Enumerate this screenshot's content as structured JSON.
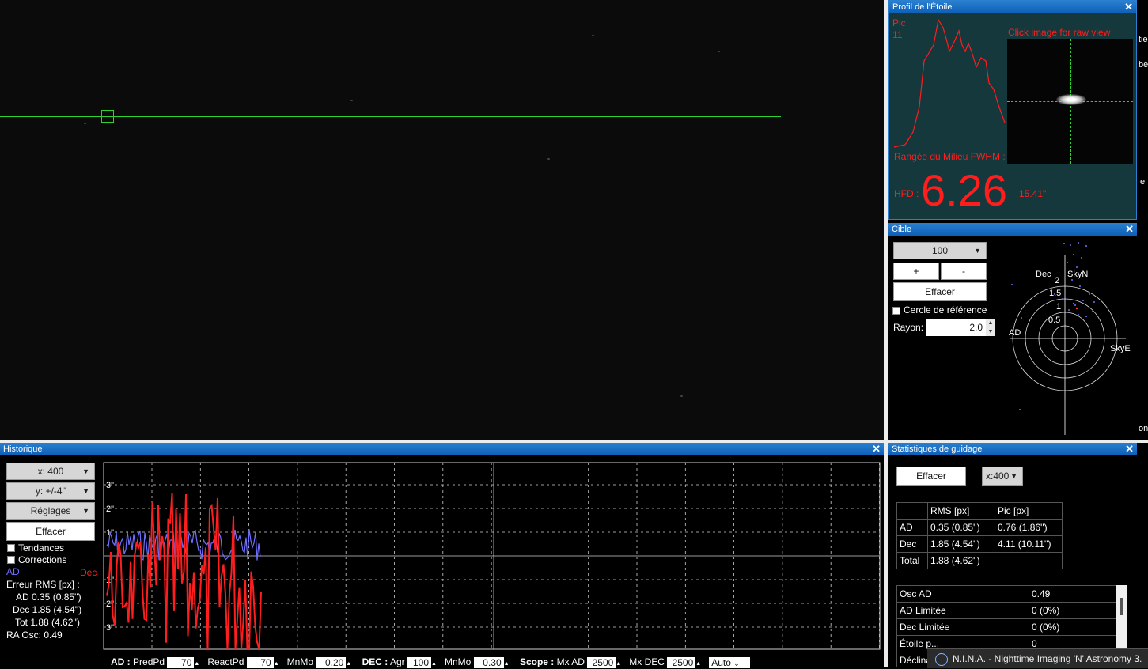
{
  "profile": {
    "title": "Profil de l'Étoile",
    "pic_label": "Pic",
    "pic_value": "11",
    "raw_hint": "Click image for raw view",
    "fwhm_label": "Rangée du Milieu FWHM :",
    "hfd_label": "HFD :",
    "hfd_value": "6.26",
    "hfd_arcsec": "15.41\""
  },
  "target": {
    "title": "Cible",
    "scale_value": "100",
    "plus": "+",
    "minus": "-",
    "clear": "Effacer",
    "ref_circle": "Cercle de référence",
    "radius_label": "Rayon:",
    "radius_value": "2.0",
    "labels": {
      "dec": "Dec",
      "skyn": "SkyN",
      "ad": "AD",
      "skye": "SkyE",
      "r2": "2",
      "r15": "1.5",
      "r1": "1",
      "r05": "0.5"
    }
  },
  "history": {
    "title": "Historique",
    "x_scale": "x: 400",
    "y_scale": "y: +/-4''",
    "settings": "Réglages",
    "clear": "Effacer",
    "trends": "Tendances",
    "corrections": "Corrections",
    "ad_legend": "AD",
    "dec_legend": "Dec",
    "rms_header": "Erreur RMS [px] :",
    "rms_ad": "AD  0.35 (0.85'')",
    "rms_dec": "Dec  1.85 (4.54'')",
    "rms_tot": "Tot  1.88 (4.62'')",
    "ra_osc": "RA Osc: 0.49",
    "y_ticks": [
      "3\"",
      "2\"",
      "1\"",
      "1\"",
      "2\"",
      "3\""
    ],
    "colors": {
      "ad": "#6f6fff",
      "dec": "#ff1e1e",
      "grid": "#cfcfcf"
    }
  },
  "stats": {
    "title": "Statistiques de guidage",
    "clear": "Effacer",
    "scale": "x:400",
    "headers": [
      "",
      "RMS [px]",
      "Pic [px]"
    ],
    "rows": [
      [
        "AD",
        "0.35 (0.85'')",
        "0.76 (1.86'')"
      ],
      [
        "Dec",
        "1.85 (4.54'')",
        "4.11 (10.11'')"
      ],
      [
        "Total",
        "1.88 (4.62'')",
        ""
      ]
    ],
    "rows2": [
      [
        "Osc AD",
        "0.49"
      ],
      [
        "AD Limitée",
        "0 (0%)"
      ],
      [
        "Dec Limitée",
        "0 (0%)"
      ],
      [
        "Étoile p...",
        "0"
      ],
      [
        "Déclina...",
        ""
      ]
    ]
  },
  "bottom_bar": {
    "ad_label": "AD :",
    "predpd_label": "PredPd",
    "predpd_value": "70",
    "reactpd_label": "ReactPd",
    "reactpd_value": "70",
    "mnmo_label": "MnMo",
    "mnmo_value": "0.20",
    "dec_label": "DEC :",
    "agr_label": "Agr",
    "agr_value": "100",
    "mnmo2_label": "MnMo",
    "mnmo2_value": "0.30",
    "scope_label": "Scope :",
    "mxad_label": "Mx AD",
    "mxad_value": "2500",
    "mxdec_label": "Mx DEC",
    "mxdec_value": "2500",
    "mode_value": "Auto"
  },
  "taskbar_tip": "N.I.N.A. - Nighttime Imaging 'N' Astronomy 3.",
  "edge_text": [
    "tiel",
    "be",
    "e",
    "on"
  ]
}
